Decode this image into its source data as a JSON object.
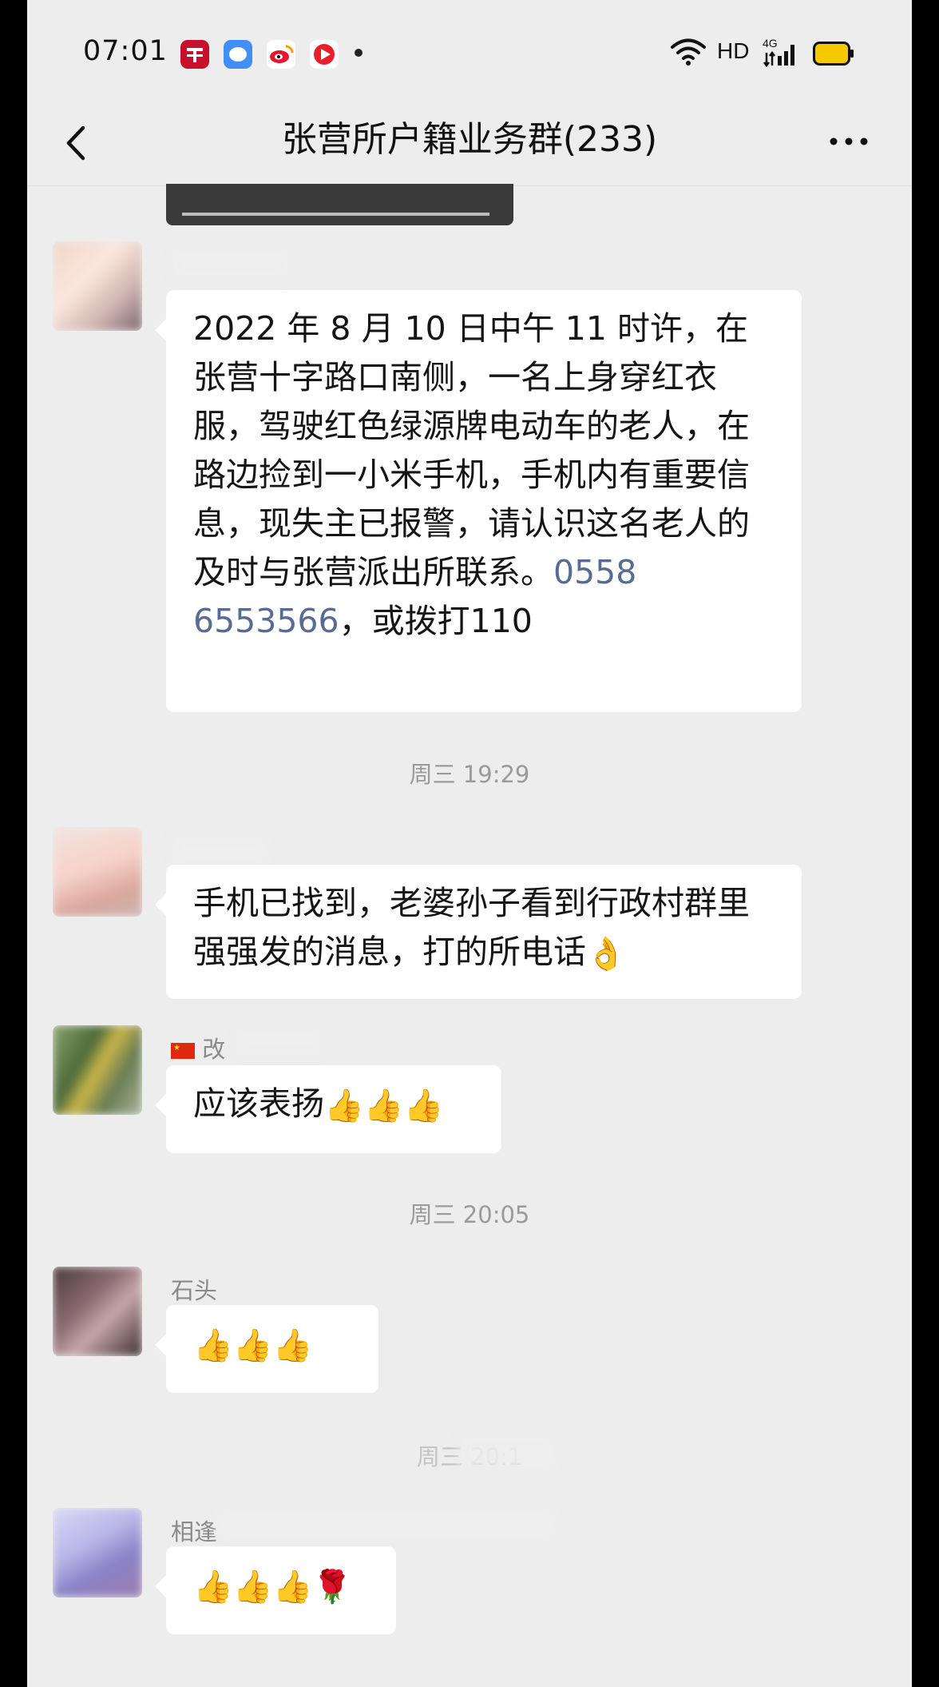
{
  "status_bar": {
    "time": "07:01",
    "hd_label": "HD",
    "network_label": "4G",
    "app_icons": [
      "xuexi-app-icon",
      "chat-bubble-app-icon",
      "weibo-app-icon",
      "video-app-icon"
    ],
    "battery_color": "#f5c800"
  },
  "nav": {
    "title": "张营所户籍业务群(233)"
  },
  "messages": [
    {
      "sender": "",
      "text_before_link": "2022 年 8 月 10 日中午 11 时许，在张营十字路口南侧，一名上身穿红衣服，驾驶红色绿源牌电动车的老人，在路边捡到一小米手机，手机内有重要信息，现失主已报警，请认识这名老人的及时与张营派出所联系。",
      "link": "0558 6553566",
      "text_after_link": "，或拨打110"
    },
    {
      "timestamp": "周三 19:29"
    },
    {
      "sender": "",
      "text": "手机已找到，老婆孙子看到行政村群里强强发的消息，打的所电话",
      "emoji": "👌"
    },
    {
      "sender": "改",
      "text": "应该表扬",
      "emoji": "👍👍👍"
    },
    {
      "timestamp": "周三 20:05"
    },
    {
      "sender": "石头",
      "text": "",
      "emoji": "👍👍👍"
    },
    {
      "timestamp": "周三 20:1"
    },
    {
      "sender": "相逢",
      "text": "",
      "emoji": "👍👍👍🌹"
    }
  ],
  "colors": {
    "chat_background": "#ededed",
    "bubble": "#ffffff",
    "link": "#576b95",
    "timestamp": "#9a9a9a"
  }
}
